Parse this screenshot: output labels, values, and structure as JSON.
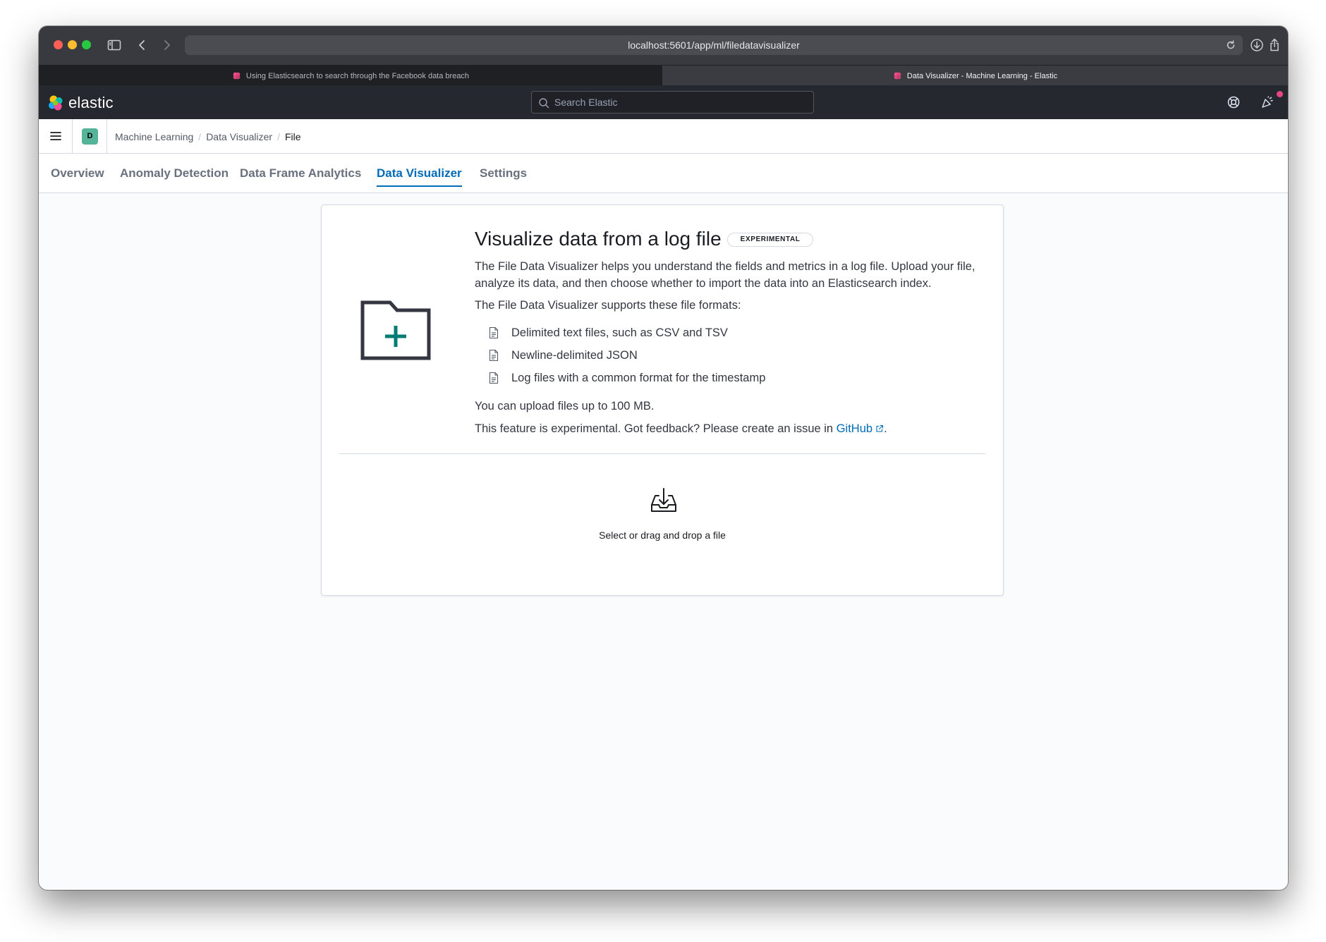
{
  "browser": {
    "url": "localhost:5601/app/ml/filedatavisualizer",
    "tabs": [
      {
        "title": "Using Elasticsearch to search through the Facebook data breach",
        "active": false
      },
      {
        "title": "Data Visualizer - Machine Learning - Elastic",
        "active": true
      }
    ]
  },
  "header": {
    "logo_text": "elastic",
    "search_placeholder": "Search Elastic"
  },
  "breadcrumb": {
    "space_initial": "D",
    "items": [
      "Machine Learning",
      "Data Visualizer",
      "File"
    ]
  },
  "nav_tabs": [
    {
      "label": "Overview",
      "active": false
    },
    {
      "label": "Anomaly Detection",
      "active": false
    },
    {
      "label": "Data Frame Analytics",
      "active": false
    },
    {
      "label": "Data Visualizer",
      "active": true
    },
    {
      "label": "Settings",
      "active": false
    }
  ],
  "panel": {
    "title": "Visualize data from a log file",
    "badge": "EXPERIMENTAL",
    "intro": "The File Data Visualizer helps you understand the fields and metrics in a log file. Upload your file, analyze its data, and then choose whether to import the data into an Elasticsearch index.",
    "supports": "The File Data Visualizer supports these file formats:",
    "formats": [
      "Delimited text files, such as CSV and TSV",
      "Newline-delimited JSON",
      "Log files with a common format for the timestamp"
    ],
    "size_limit": "You can upload files up to 100 MB.",
    "feedback_prefix": "This feature is experimental. Got feedback? Please create an issue in ",
    "feedback_link": "GitHub",
    "feedback_suffix": ".",
    "drop_text": "Select or drag and drop a file"
  },
  "colors": {
    "accent": "#006bb8",
    "header_bg": "#25282f",
    "space_avatar": "#54b399",
    "folder_plus": "#017d73",
    "notification": "#e7477f"
  },
  "icons": [
    "sidebar-icon",
    "back-icon",
    "forward-icon",
    "reload-icon",
    "download-icon",
    "share-icon",
    "elastic-logo-icon",
    "search-icon",
    "help-icon",
    "newsfeed-icon",
    "menu-icon",
    "folder-add-icon",
    "document-icon",
    "external-link-icon",
    "import-icon"
  ]
}
